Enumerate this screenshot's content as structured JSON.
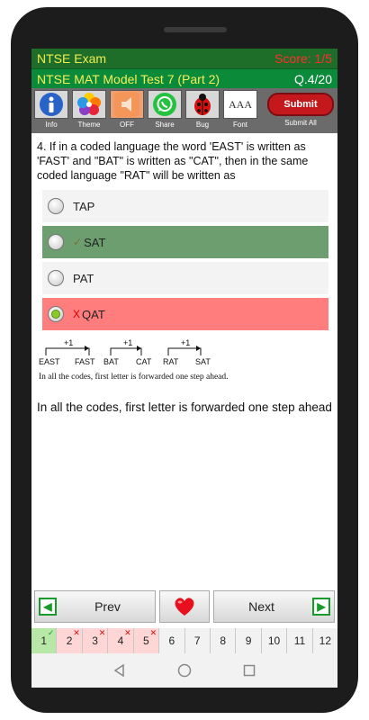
{
  "app": {
    "title": "NTSE Exam",
    "score": "Score: 1/5"
  },
  "test": {
    "title": "NTSE MAT Model Test 7 (Part 2)",
    "question_number": "Q.4/20"
  },
  "toolbar": {
    "info_label": "Info",
    "theme_label": "Theme",
    "sound_label": "OFF",
    "share_label": "Share",
    "bug_label": "Bug",
    "font_label": "Font",
    "font_icon_text": "AAA",
    "submit_button": "Submit",
    "submit_all_label": "Submit All"
  },
  "question": {
    "text": "4. If in a coded language the word 'EAST' is written as 'FAST' and \"BAT\" is written as \"CAT\", then in the same coded language \"RAT\" will be written as"
  },
  "options": [
    {
      "label": "TAP",
      "state": "normal",
      "mark": ""
    },
    {
      "label": "SAT",
      "state": "correct",
      "mark": "✓"
    },
    {
      "label": "PAT",
      "state": "normal",
      "mark": ""
    },
    {
      "label": "QAT",
      "state": "wrong",
      "mark": "X"
    }
  ],
  "diagram": {
    "pairs": [
      {
        "from": "EAST",
        "to": "FAST",
        "step": "+1"
      },
      {
        "from": "BAT",
        "to": "CAT",
        "step": "+1"
      },
      {
        "from": "RAT",
        "to": "SAT",
        "step": "+1"
      }
    ],
    "caption": "In all the codes, first letter is forwarded one step ahead."
  },
  "explanation": "In all the codes, first letter is forwarded one step ahead",
  "nav": {
    "prev": "Prev",
    "next": "Next"
  },
  "question_grid": [
    {
      "n": "1",
      "status": "correct"
    },
    {
      "n": "2",
      "status": "wrong"
    },
    {
      "n": "3",
      "status": "wrong"
    },
    {
      "n": "4",
      "status": "wrong"
    },
    {
      "n": "5",
      "status": "wrong"
    },
    {
      "n": "6",
      "status": "none"
    },
    {
      "n": "7",
      "status": "none"
    },
    {
      "n": "8",
      "status": "none"
    },
    {
      "n": "9",
      "status": "none"
    },
    {
      "n": "10",
      "status": "none"
    },
    {
      "n": "11",
      "status": "none"
    },
    {
      "n": "12",
      "status": "none"
    }
  ],
  "colors": {
    "correct": "#6c9e6f",
    "wrong": "#ff7d7d",
    "appbar": "#1e6e2a",
    "titlebar": "#0b8a3a"
  }
}
